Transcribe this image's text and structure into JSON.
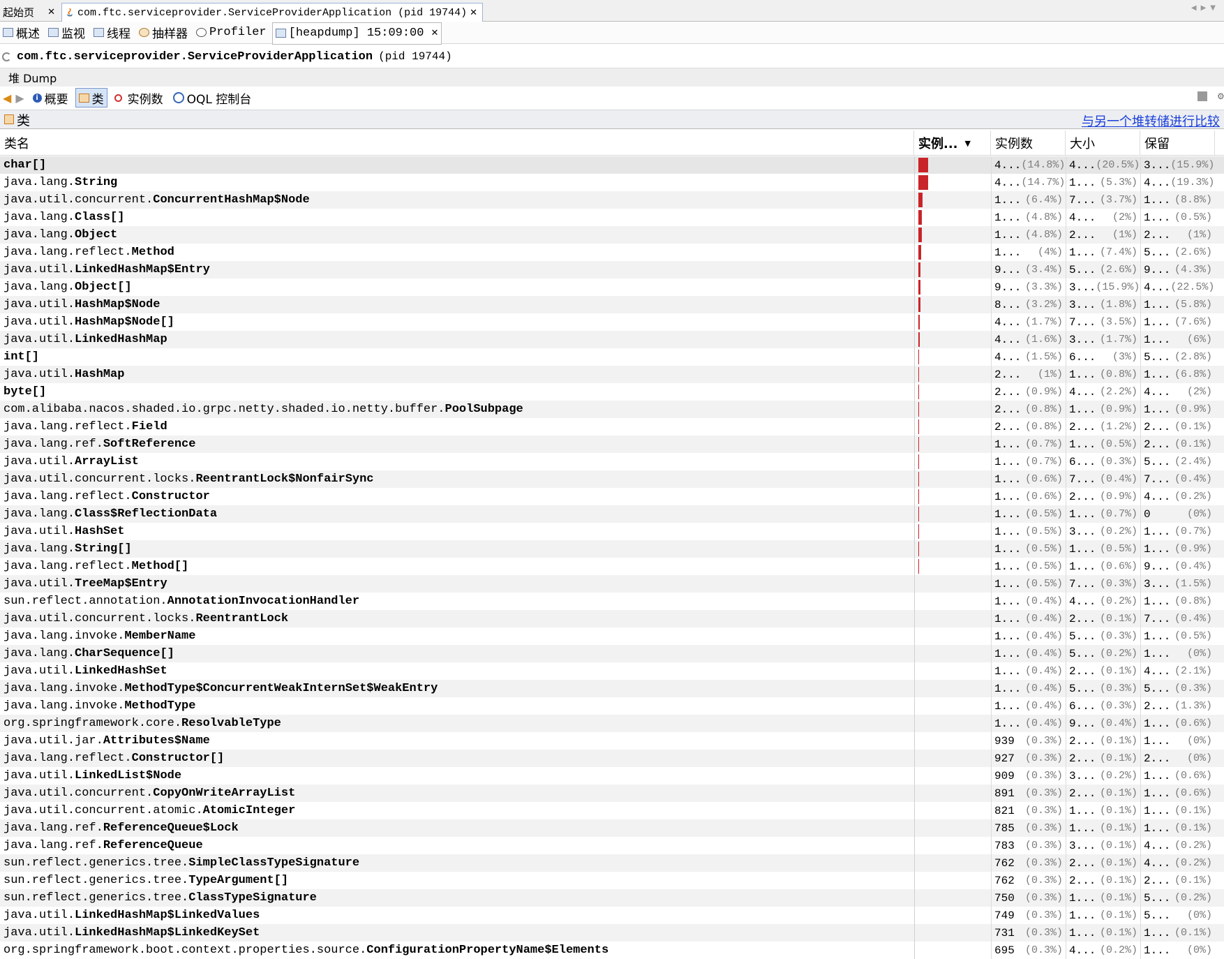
{
  "tabs": {
    "start_label": "起始页",
    "app_label": "com.ftc.serviceprovider.ServiceProviderApplication (pid 19744)",
    "close_glyph": "✕"
  },
  "subtabs": [
    {
      "label": "概述",
      "icon": "overview-icon"
    },
    {
      "label": "监视",
      "icon": "monitor-icon"
    },
    {
      "label": "线程",
      "icon": "threads-icon"
    },
    {
      "label": "抽样器",
      "icon": "sampler-icon"
    },
    {
      "label": "Profiler",
      "icon": "profiler-icon"
    },
    {
      "label": "[heapdump] 15:09:00",
      "icon": "heapdump-icon"
    }
  ],
  "app_title": {
    "name": "com.ftc.serviceprovider.ServiceProviderApplication",
    "pid": "(pid 19744)"
  },
  "heap_label": "堆 Dump",
  "toolbar": {
    "summary": "概要",
    "classes": "类",
    "instances": "实例数",
    "oql": "OQL 控制台"
  },
  "classes_header": {
    "title": "类",
    "compare_link": "与另一个堆转储进行比较"
  },
  "columns": {
    "name": "类名",
    "bar": "实例...",
    "instances": "实例数",
    "size": "大小",
    "retained": "保留"
  },
  "colors": {
    "bar": "#c9242a",
    "link": "#1a3fd9"
  },
  "rows": [
    {
      "pkg": "",
      "cls": "char[]",
      "bar": 14.8,
      "inst": "4...",
      "inst_p": "(14.8%)",
      "size": "4...",
      "size_p": "(20.5%)",
      "ret": "3...",
      "ret_p": "(15.9%)"
    },
    {
      "pkg": "java.lang.",
      "cls": "String",
      "bar": 14.7,
      "inst": "4...",
      "inst_p": "(14.7%)",
      "size": "1...",
      "size_p": "(5.3%)",
      "ret": "4...",
      "ret_p": "(19.3%)"
    },
    {
      "pkg": "java.util.concurrent.",
      "cls": "ConcurrentHashMap$Node",
      "bar": 6.4,
      "inst": "1...",
      "inst_p": "(6.4%)",
      "size": "7...",
      "size_p": "(3.7%)",
      "ret": "1...",
      "ret_p": "(8.8%)"
    },
    {
      "pkg": "java.lang.",
      "cls": "Class[]",
      "bar": 4.8,
      "inst": "1...",
      "inst_p": "(4.8%)",
      "size": "4...",
      "size_p": "(2%)",
      "ret": "1...",
      "ret_p": "(0.5%)"
    },
    {
      "pkg": "java.lang.",
      "cls": "Object",
      "bar": 4.8,
      "inst": "1...",
      "inst_p": "(4.8%)",
      "size": "2...",
      "size_p": "(1%)",
      "ret": "2...",
      "ret_p": "(1%)"
    },
    {
      "pkg": "java.lang.reflect.",
      "cls": "Method",
      "bar": 4,
      "inst": "1...",
      "inst_p": "(4%)",
      "size": "1...",
      "size_p": "(7.4%)",
      "ret": "5...",
      "ret_p": "(2.6%)"
    },
    {
      "pkg": "java.util.",
      "cls": "LinkedHashMap$Entry",
      "bar": 3.4,
      "inst": "9...",
      "inst_p": "(3.4%)",
      "size": "5...",
      "size_p": "(2.6%)",
      "ret": "9...",
      "ret_p": "(4.3%)"
    },
    {
      "pkg": "java.lang.",
      "cls": "Object[]",
      "bar": 3.3,
      "inst": "9...",
      "inst_p": "(3.3%)",
      "size": "3...",
      "size_p": "(15.9%)",
      "ret": "4...",
      "ret_p": "(22.5%)"
    },
    {
      "pkg": "java.util.",
      "cls": "HashMap$Node",
      "bar": 3.2,
      "inst": "8...",
      "inst_p": "(3.2%)",
      "size": "3...",
      "size_p": "(1.8%)",
      "ret": "1...",
      "ret_p": "(5.8%)"
    },
    {
      "pkg": "java.util.",
      "cls": "HashMap$Node[]",
      "bar": 1.7,
      "inst": "4...",
      "inst_p": "(1.7%)",
      "size": "7...",
      "size_p": "(3.5%)",
      "ret": "1...",
      "ret_p": "(7.6%)"
    },
    {
      "pkg": "java.util.",
      "cls": "LinkedHashMap",
      "bar": 1.6,
      "inst": "4...",
      "inst_p": "(1.6%)",
      "size": "3...",
      "size_p": "(1.7%)",
      "ret": "1...",
      "ret_p": "(6%)"
    },
    {
      "pkg": "",
      "cls": "int[]",
      "bar": 1.5,
      "inst": "4...",
      "inst_p": "(1.5%)",
      "size": "6...",
      "size_p": "(3%)",
      "ret": "5...",
      "ret_p": "(2.8%)"
    },
    {
      "pkg": "java.util.",
      "cls": "HashMap",
      "bar": 1,
      "inst": "2...",
      "inst_p": "(1%)",
      "size": "1...",
      "size_p": "(0.8%)",
      "ret": "1...",
      "ret_p": "(6.8%)"
    },
    {
      "pkg": "",
      "cls": "byte[]",
      "bar": 0.9,
      "inst": "2...",
      "inst_p": "(0.9%)",
      "size": "4...",
      "size_p": "(2.2%)",
      "ret": "4...",
      "ret_p": "(2%)"
    },
    {
      "pkg": "com.alibaba.nacos.shaded.io.grpc.netty.shaded.io.netty.buffer.",
      "cls": "PoolSubpage",
      "bar": 0.8,
      "inst": "2...",
      "inst_p": "(0.8%)",
      "size": "1...",
      "size_p": "(0.9%)",
      "ret": "1...",
      "ret_p": "(0.9%)"
    },
    {
      "pkg": "java.lang.reflect.",
      "cls": "Field",
      "bar": 0.8,
      "inst": "2...",
      "inst_p": "(0.8%)",
      "size": "2...",
      "size_p": "(1.2%)",
      "ret": "2...",
      "ret_p": "(0.1%)"
    },
    {
      "pkg": "java.lang.ref.",
      "cls": "SoftReference",
      "bar": 0.7,
      "inst": "1...",
      "inst_p": "(0.7%)",
      "size": "1...",
      "size_p": "(0.5%)",
      "ret": "2...",
      "ret_p": "(0.1%)"
    },
    {
      "pkg": "java.util.",
      "cls": "ArrayList",
      "bar": 0.7,
      "inst": "1...",
      "inst_p": "(0.7%)",
      "size": "6...",
      "size_p": "(0.3%)",
      "ret": "5...",
      "ret_p": "(2.4%)"
    },
    {
      "pkg": "java.util.concurrent.locks.",
      "cls": "ReentrantLock$NonfairSync",
      "bar": 0.6,
      "inst": "1...",
      "inst_p": "(0.6%)",
      "size": "7...",
      "size_p": "(0.4%)",
      "ret": "7...",
      "ret_p": "(0.4%)"
    },
    {
      "pkg": "java.lang.reflect.",
      "cls": "Constructor",
      "bar": 0.6,
      "inst": "1...",
      "inst_p": "(0.6%)",
      "size": "2...",
      "size_p": "(0.9%)",
      "ret": "4...",
      "ret_p": "(0.2%)"
    },
    {
      "pkg": "java.lang.",
      "cls": "Class$ReflectionData",
      "bar": 0.5,
      "inst": "1...",
      "inst_p": "(0.5%)",
      "size": "1...",
      "size_p": "(0.7%)",
      "ret": "0",
      "ret_p": "(0%)"
    },
    {
      "pkg": "java.util.",
      "cls": "HashSet",
      "bar": 0.5,
      "inst": "1...",
      "inst_p": "(0.5%)",
      "size": "3...",
      "size_p": "(0.2%)",
      "ret": "1...",
      "ret_p": "(0.7%)"
    },
    {
      "pkg": "java.lang.",
      "cls": "String[]",
      "bar": 0.5,
      "inst": "1...",
      "inst_p": "(0.5%)",
      "size": "1...",
      "size_p": "(0.5%)",
      "ret": "1...",
      "ret_p": "(0.9%)"
    },
    {
      "pkg": "java.lang.reflect.",
      "cls": "Method[]",
      "bar": 0.5,
      "inst": "1...",
      "inst_p": "(0.5%)",
      "size": "1...",
      "size_p": "(0.6%)",
      "ret": "9...",
      "ret_p": "(0.4%)"
    },
    {
      "pkg": "java.util.",
      "cls": "TreeMap$Entry",
      "bar": 0,
      "inst": "1...",
      "inst_p": "(0.5%)",
      "size": "7...",
      "size_p": "(0.3%)",
      "ret": "3...",
      "ret_p": "(1.5%)"
    },
    {
      "pkg": "sun.reflect.annotation.",
      "cls": "AnnotationInvocationHandler",
      "bar": 0,
      "inst": "1...",
      "inst_p": "(0.4%)",
      "size": "4...",
      "size_p": "(0.2%)",
      "ret": "1...",
      "ret_p": "(0.8%)"
    },
    {
      "pkg": "java.util.concurrent.locks.",
      "cls": "ReentrantLock",
      "bar": 0,
      "inst": "1...",
      "inst_p": "(0.4%)",
      "size": "2...",
      "size_p": "(0.1%)",
      "ret": "7...",
      "ret_p": "(0.4%)"
    },
    {
      "pkg": "java.lang.invoke.",
      "cls": "MemberName",
      "bar": 0,
      "inst": "1...",
      "inst_p": "(0.4%)",
      "size": "5...",
      "size_p": "(0.3%)",
      "ret": "1...",
      "ret_p": "(0.5%)"
    },
    {
      "pkg": "java.lang.",
      "cls": "CharSequence[]",
      "bar": 0,
      "inst": "1...",
      "inst_p": "(0.4%)",
      "size": "5...",
      "size_p": "(0.2%)",
      "ret": "1...",
      "ret_p": "(0%)"
    },
    {
      "pkg": "java.util.",
      "cls": "LinkedHashSet",
      "bar": 0,
      "inst": "1...",
      "inst_p": "(0.4%)",
      "size": "2...",
      "size_p": "(0.1%)",
      "ret": "4...",
      "ret_p": "(2.1%)"
    },
    {
      "pkg": "java.lang.invoke.",
      "cls": "MethodType$ConcurrentWeakInternSet$WeakEntry",
      "bar": 0,
      "inst": "1...",
      "inst_p": "(0.4%)",
      "size": "5...",
      "size_p": "(0.3%)",
      "ret": "5...",
      "ret_p": "(0.3%)"
    },
    {
      "pkg": "java.lang.invoke.",
      "cls": "MethodType",
      "bar": 0,
      "inst": "1...",
      "inst_p": "(0.4%)",
      "size": "6...",
      "size_p": "(0.3%)",
      "ret": "2...",
      "ret_p": "(1.3%)"
    },
    {
      "pkg": "org.springframework.core.",
      "cls": "ResolvableType",
      "bar": 0,
      "inst": "1...",
      "inst_p": "(0.4%)",
      "size": "9...",
      "size_p": "(0.4%)",
      "ret": "1...",
      "ret_p": "(0.6%)"
    },
    {
      "pkg": "java.util.jar.",
      "cls": "Attributes$Name",
      "bar": 0,
      "inst": "939",
      "inst_p": "(0.3%)",
      "size": "2...",
      "size_p": "(0.1%)",
      "ret": "1...",
      "ret_p": "(0%)"
    },
    {
      "pkg": "java.lang.reflect.",
      "cls": "Constructor[]",
      "bar": 0,
      "inst": "927",
      "inst_p": "(0.3%)",
      "size": "2...",
      "size_p": "(0.1%)",
      "ret": "2...",
      "ret_p": "(0%)"
    },
    {
      "pkg": "java.util.",
      "cls": "LinkedList$Node",
      "bar": 0,
      "inst": "909",
      "inst_p": "(0.3%)",
      "size": "3...",
      "size_p": "(0.2%)",
      "ret": "1...",
      "ret_p": "(0.6%)"
    },
    {
      "pkg": "java.util.concurrent.",
      "cls": "CopyOnWriteArrayList",
      "bar": 0,
      "inst": "891",
      "inst_p": "(0.3%)",
      "size": "2...",
      "size_p": "(0.1%)",
      "ret": "1...",
      "ret_p": "(0.6%)"
    },
    {
      "pkg": "java.util.concurrent.atomic.",
      "cls": "AtomicInteger",
      "bar": 0,
      "inst": "821",
      "inst_p": "(0.3%)",
      "size": "1...",
      "size_p": "(0.1%)",
      "ret": "1...",
      "ret_p": "(0.1%)"
    },
    {
      "pkg": "java.lang.ref.",
      "cls": "ReferenceQueue$Lock",
      "bar": 0,
      "inst": "785",
      "inst_p": "(0.3%)",
      "size": "1...",
      "size_p": "(0.1%)",
      "ret": "1...",
      "ret_p": "(0.1%)"
    },
    {
      "pkg": "java.lang.ref.",
      "cls": "ReferenceQueue",
      "bar": 0,
      "inst": "783",
      "inst_p": "(0.3%)",
      "size": "3...",
      "size_p": "(0.1%)",
      "ret": "4...",
      "ret_p": "(0.2%)"
    },
    {
      "pkg": "sun.reflect.generics.tree.",
      "cls": "SimpleClassTypeSignature",
      "bar": 0,
      "inst": "762",
      "inst_p": "(0.3%)",
      "size": "2...",
      "size_p": "(0.1%)",
      "ret": "4...",
      "ret_p": "(0.2%)"
    },
    {
      "pkg": "sun.reflect.generics.tree.",
      "cls": "TypeArgument[]",
      "bar": 0,
      "inst": "762",
      "inst_p": "(0.3%)",
      "size": "2...",
      "size_p": "(0.1%)",
      "ret": "2...",
      "ret_p": "(0.1%)"
    },
    {
      "pkg": "sun.reflect.generics.tree.",
      "cls": "ClassTypeSignature",
      "bar": 0,
      "inst": "750",
      "inst_p": "(0.3%)",
      "size": "1...",
      "size_p": "(0.1%)",
      "ret": "5...",
      "ret_p": "(0.2%)"
    },
    {
      "pkg": "java.util.",
      "cls": "LinkedHashMap$LinkedValues",
      "bar": 0,
      "inst": "749",
      "inst_p": "(0.3%)",
      "size": "1...",
      "size_p": "(0.1%)",
      "ret": "5...",
      "ret_p": "(0%)"
    },
    {
      "pkg": "java.util.",
      "cls": "LinkedHashMap$LinkedKeySet",
      "bar": 0,
      "inst": "731",
      "inst_p": "(0.3%)",
      "size": "1...",
      "size_p": "(0.1%)",
      "ret": "1...",
      "ret_p": "(0.1%)"
    },
    {
      "pkg": "org.springframework.boot.context.properties.source.",
      "cls": "ConfigurationPropertyName$Elements",
      "bar": 0,
      "inst": "695",
      "inst_p": "(0.3%)",
      "size": "4...",
      "size_p": "(0.2%)",
      "ret": "1...",
      "ret_p": "(0%)"
    }
  ]
}
